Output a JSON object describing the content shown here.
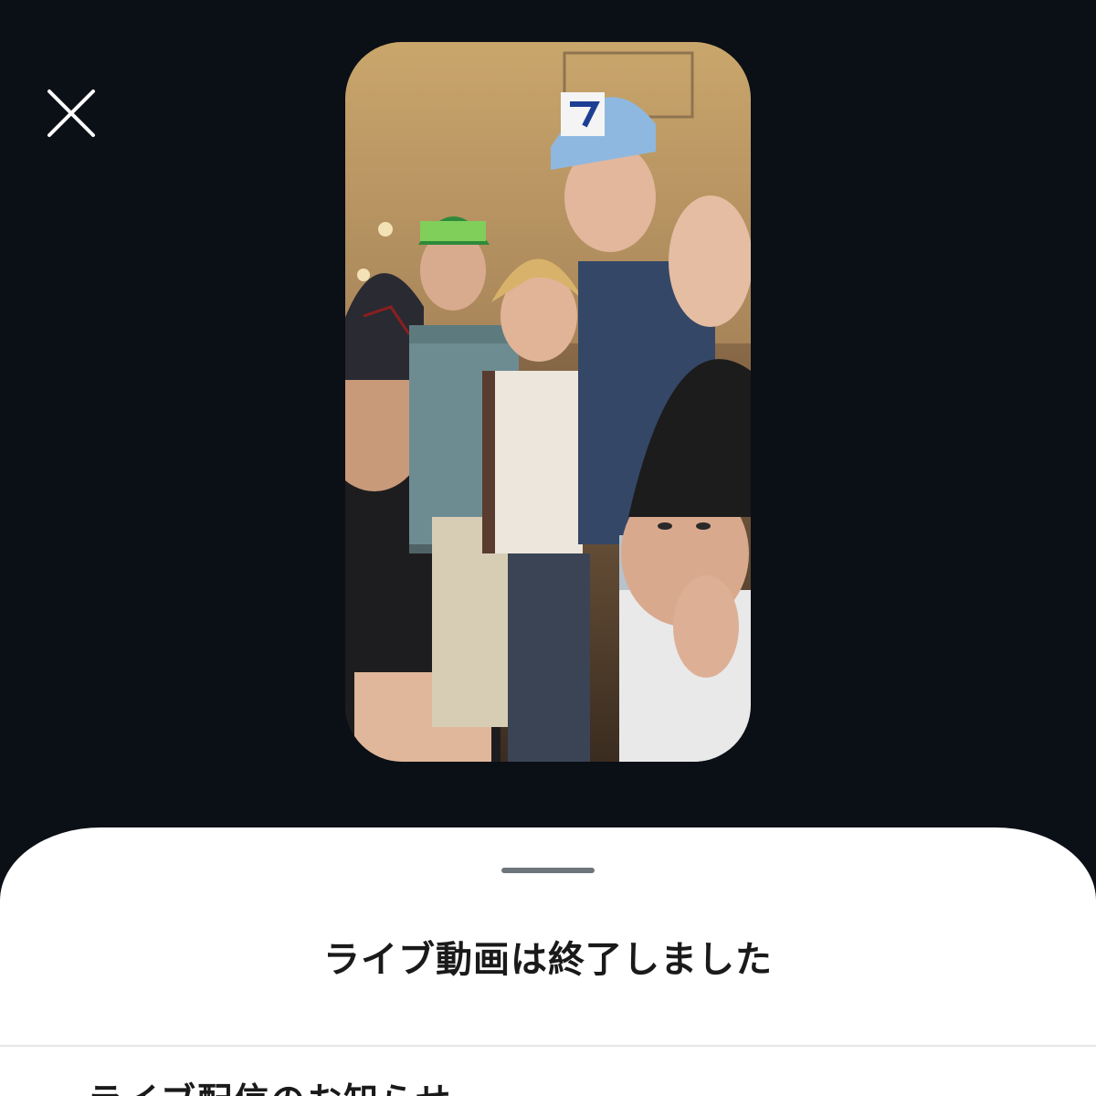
{
  "live_ended": {
    "title": "ライブ動画は終了しました",
    "next_item_label": "ライブ配信のお知らせ"
  },
  "icons": {
    "close": "close-icon"
  },
  "colors": {
    "background": "#0b0f16",
    "sheet": "#ffffff",
    "handle": "#6e757c",
    "title_text": "#1a1a1a"
  }
}
